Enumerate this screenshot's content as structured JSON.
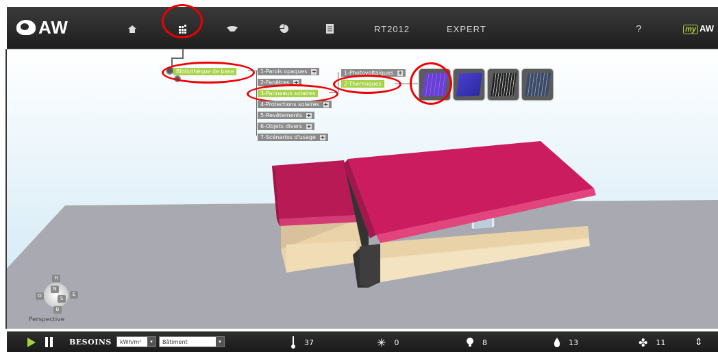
{
  "header": {
    "logo_text": "AW",
    "nav": [
      {
        "type": "icon",
        "icon": "home-icon"
      },
      {
        "type": "icon",
        "icon": "library-grid-icon"
      },
      {
        "type": "icon",
        "icon": "roof-icon"
      },
      {
        "type": "icon",
        "icon": "pie-chart-icon"
      },
      {
        "type": "icon",
        "icon": "document-icon"
      },
      {
        "type": "text",
        "label": "RT2012"
      },
      {
        "type": "text",
        "label": "EXPERT"
      }
    ],
    "help_label": "?",
    "myaw": {
      "prefix": "my",
      "label": "AW"
    }
  },
  "library_menu": {
    "root": "Bibliothèque de base",
    "level1": [
      "1-Parois opaques",
      "2-Fenêtres",
      "3-Panneaux solaires",
      "4-Protections solaires",
      "5-Revêtements",
      "6-Objets divers",
      "7-Scénarios d'usage"
    ],
    "level2": [
      "1-Photovoltaïques",
      "2-Thermiques"
    ],
    "thumbnails": [
      "solar-panel-violet",
      "solar-panel-blue",
      "solar-panel-tubes",
      "solar-panel-gray"
    ]
  },
  "navigation_compass": {
    "labels": {
      "north_top": "H",
      "n": "N",
      "o": "O",
      "e": "E",
      "s": "S",
      "b": "B"
    },
    "view_label": "Perspective"
  },
  "footer": {
    "besoins_label": "BESOINS",
    "unit_select": "kWh/m²",
    "scope_select": "Bâtiment",
    "stats": [
      {
        "icon": "thermometer-icon",
        "value": "37"
      },
      {
        "icon": "snowflake-icon",
        "value": "0"
      },
      {
        "icon": "lightbulb-icon",
        "value": "8"
      },
      {
        "icon": "water-drop-icon",
        "value": "13"
      },
      {
        "icon": "fan-icon",
        "value": "11"
      }
    ]
  },
  "colors": {
    "roof": "#cf1f63",
    "wall": "#f2dcb4",
    "ground": "#a9aab1",
    "active_menu": "#a8d24a",
    "highlight": "#e00000"
  }
}
